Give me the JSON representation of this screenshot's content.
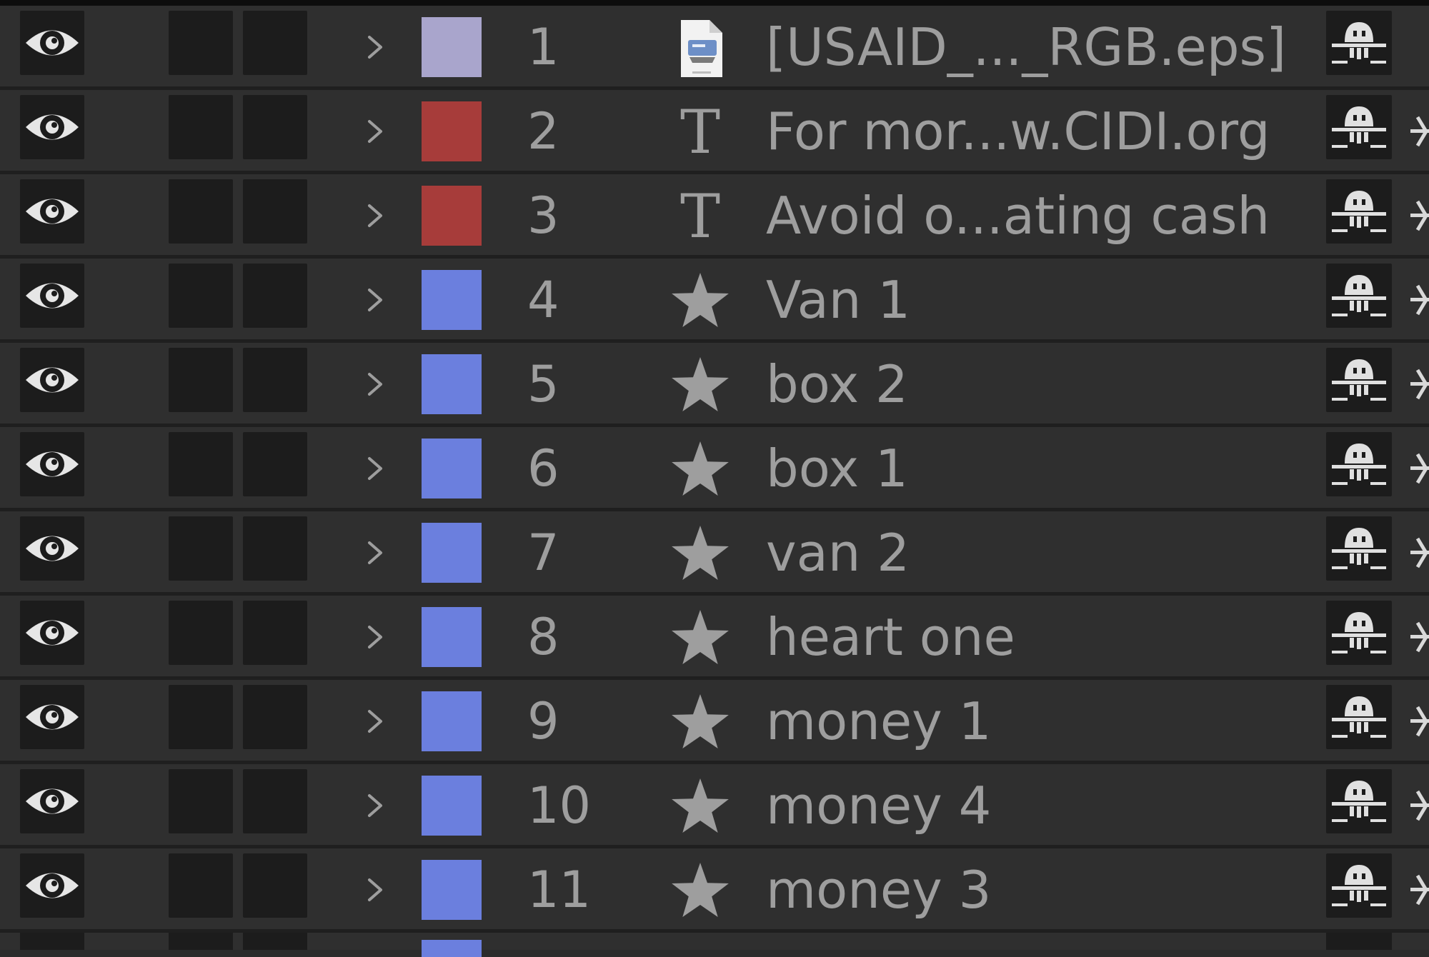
{
  "colors": {
    "background": "#2b2b2b",
    "row_background": "#2f2f2f",
    "cell_dark": "#1c1c1c",
    "icon_gray": "#9e9e9e",
    "label_lavender": "#a9a5cc",
    "label_red": "#a73c3a",
    "label_blue": "#6b7fde"
  },
  "layers": [
    {
      "number": "1",
      "name": "[USAID_..._RGB.eps]",
      "type": "footage-file-icon",
      "label_color": "#a9a5cc",
      "visible": true,
      "has_edge_switch": false
    },
    {
      "number": "2",
      "name": "For mor...w.CIDI.org",
      "type": "text-layer-icon",
      "label_color": "#a73c3a",
      "visible": true,
      "has_edge_switch": true
    },
    {
      "number": "3",
      "name": "Avoid o...ating cash",
      "type": "text-layer-icon",
      "label_color": "#a73c3a",
      "visible": true,
      "has_edge_switch": true
    },
    {
      "number": "4",
      "name": "Van 1",
      "type": "shape-layer-star-icon",
      "label_color": "#6b7fde",
      "visible": true,
      "has_edge_switch": true
    },
    {
      "number": "5",
      "name": "box 2",
      "type": "shape-layer-star-icon",
      "label_color": "#6b7fde",
      "visible": true,
      "has_edge_switch": true
    },
    {
      "number": "6",
      "name": "box 1",
      "type": "shape-layer-star-icon",
      "label_color": "#6b7fde",
      "visible": true,
      "has_edge_switch": true
    },
    {
      "number": "7",
      "name": "van 2",
      "type": "shape-layer-star-icon",
      "label_color": "#6b7fde",
      "visible": true,
      "has_edge_switch": true
    },
    {
      "number": "8",
      "name": "heart one",
      "type": "shape-layer-star-icon",
      "label_color": "#6b7fde",
      "visible": true,
      "has_edge_switch": true
    },
    {
      "number": "9",
      "name": "money 1",
      "type": "shape-layer-star-icon",
      "label_color": "#6b7fde",
      "visible": true,
      "has_edge_switch": true
    },
    {
      "number": "10",
      "name": "money 4",
      "type": "shape-layer-star-icon",
      "label_color": "#6b7fde",
      "visible": true,
      "has_edge_switch": true
    },
    {
      "number": "11",
      "name": "money 3",
      "type": "shape-layer-star-icon",
      "label_color": "#6b7fde",
      "visible": true,
      "has_edge_switch": true
    }
  ],
  "partial_layer": {
    "label_color": "#6b7fde",
    "type": "shape-layer-star-icon"
  }
}
